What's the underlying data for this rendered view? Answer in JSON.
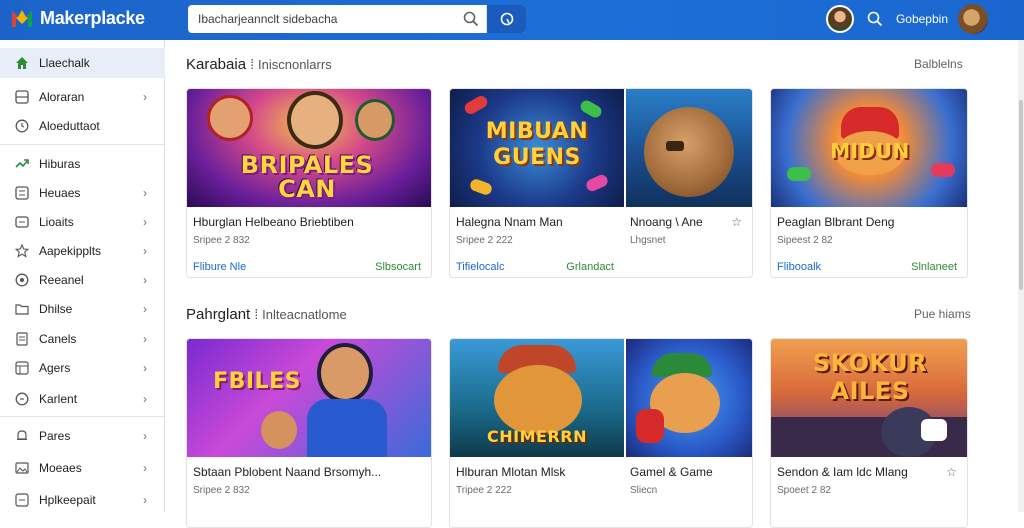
{
  "header": {
    "logo_text": "Makerplacke",
    "search_value": "Ibacharjeannclt sidebacha",
    "right_label": "Gobepbin"
  },
  "sidebar": {
    "items": [
      {
        "label": "Llaechalk",
        "icon": "home-icon",
        "chevron": false,
        "active": true
      },
      {
        "label": "Aloraran",
        "icon": "grid-icon",
        "chevron": true
      },
      {
        "label": "Aloeduttaot",
        "icon": "clock-icon",
        "chevron": false
      },
      {
        "label": "Hiburas",
        "icon": "trending-icon",
        "chevron": false
      },
      {
        "label": "Heuaes",
        "icon": "list-icon",
        "chevron": true
      },
      {
        "label": "Lioaits",
        "icon": "tag-icon",
        "chevron": true
      },
      {
        "label": "Aapekipplts",
        "icon": "star-icon",
        "chevron": true
      },
      {
        "label": "Reeanel",
        "icon": "circle-icon",
        "chevron": true
      },
      {
        "label": "Dhilse",
        "icon": "folder-icon",
        "chevron": true
      },
      {
        "label": "Canels",
        "icon": "document-icon",
        "chevron": true
      },
      {
        "label": "Agers",
        "icon": "layers-icon",
        "chevron": true
      },
      {
        "label": "Karlent",
        "icon": "target-icon",
        "chevron": true
      },
      {
        "label": "Pares",
        "icon": "bell-icon",
        "chevron": true
      },
      {
        "label": "Moeaes",
        "icon": "image-icon",
        "chevron": true
      },
      {
        "label": "Hplkeepait",
        "icon": "help-icon",
        "chevron": true
      }
    ]
  },
  "sections": [
    {
      "title": "Karabaia",
      "subtitle": "Iniscnonlarrs",
      "see_all": "Balblelns",
      "cards": [
        {
          "thumb_text": "BRIPALES\nCAN",
          "title": "Hburglan Helbeano Briebtiben",
          "meta": "Sripee 2 832",
          "link": "Flibure Nle",
          "action": "Slbsocart"
        },
        {
          "thumb_text": "MIBUAN\nGUENS",
          "title": "Halegna Nnam Man",
          "meta": "Sripee 2 222",
          "link": "Tifielocalc",
          "action": "Grlandact"
        },
        {
          "thumb_text": "",
          "title": "Nnoang \\ Ane",
          "meta": "Lhgsnet",
          "link": "",
          "action": ""
        },
        {
          "thumb_text": "MIDUN",
          "title": "Peaglan Blbrant Deng",
          "meta": "Sipeest 2 82",
          "link": "Flibooalk",
          "action": "Slnlaneet"
        }
      ]
    },
    {
      "title": "Pahrglant",
      "subtitle": "Inlteacnatlome",
      "see_all": "Pue hiams",
      "cards": [
        {
          "thumb_text": "FBILES",
          "title": "Sbtaan Pblobent Naand Brsomyh...",
          "meta": "Sripee 2 832",
          "link": "",
          "action": ""
        },
        {
          "thumb_text": "CHIMERRN",
          "title": "Hlburan Mlotan Mlsk",
          "meta": "Tripee 2 222",
          "link": "",
          "action": ""
        },
        {
          "thumb_text": "",
          "title": "Gamel & Game",
          "meta": "Sliecn",
          "link": "",
          "action": ""
        },
        {
          "thumb_text": "SKOKUR\nAILES",
          "title": "Sendon & Iam ldc Mlang",
          "meta": "Spoeet 2 82",
          "link": "",
          "action": ""
        }
      ]
    }
  ]
}
